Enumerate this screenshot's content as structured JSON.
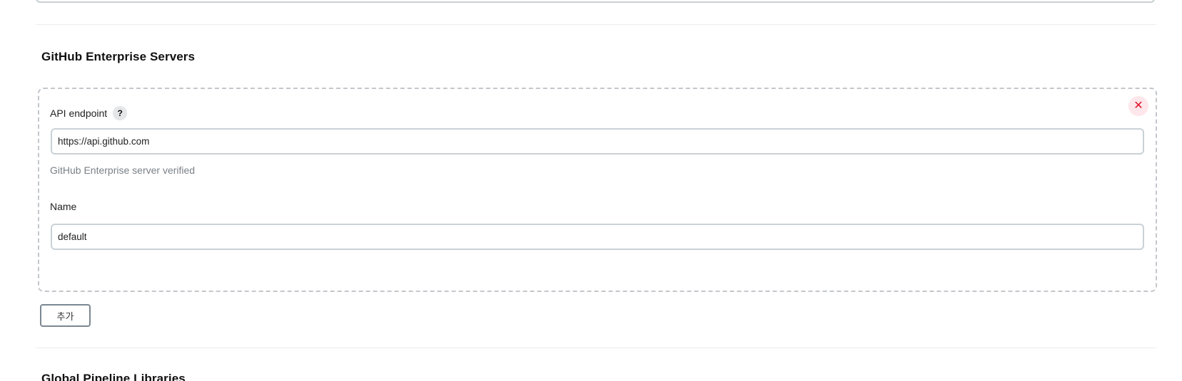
{
  "sections": {
    "github_enterprise": {
      "title": "GitHub Enterprise Servers",
      "servers": [
        {
          "api_endpoint": {
            "label": "API endpoint",
            "help_glyph": "?",
            "value": "https://api.github.com",
            "status": "GitHub Enterprise server verified"
          },
          "name": {
            "label": "Name",
            "value": "default"
          },
          "delete_glyph": "✕"
        }
      ],
      "add_label": "추가"
    },
    "global_pipeline_libraries": {
      "title": "Global Pipeline Libraries"
    }
  },
  "colors": {
    "delete_bg": "#fde7ea",
    "delete_fg": "#e0112b",
    "muted_text": "#7a8087",
    "input_border": "#c9d2d6"
  }
}
